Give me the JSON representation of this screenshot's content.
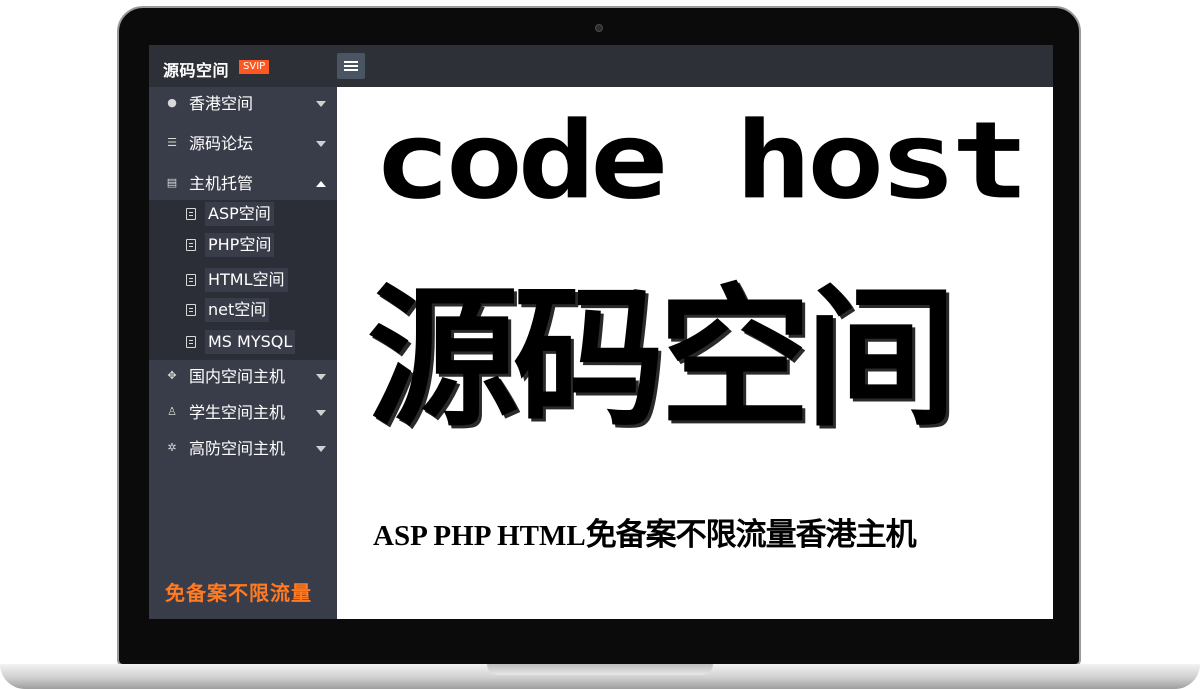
{
  "header": {
    "logo_text": "源码空间",
    "badge": "SVIP",
    "menu_icon": "hamburger-icon"
  },
  "sidebar": {
    "items": [
      {
        "label": "香港空间",
        "icon": "globe-icon"
      },
      {
        "label": "源码论坛",
        "icon": "sliders-icon"
      },
      {
        "label": "主机托管",
        "icon": "document-icon",
        "expanded": true
      },
      {
        "label": "国内空间主机",
        "icon": "expand-icon"
      },
      {
        "label": "学生空间主机",
        "icon": "user-icon"
      },
      {
        "label": "高防空间主机",
        "icon": "gear-icon"
      }
    ],
    "submenu": [
      {
        "label": "ASP空间",
        "icon": "file-icon"
      },
      {
        "label": "PHP空间",
        "icon": "file-icon"
      },
      {
        "label": "HTML空间",
        "icon": "file-icon"
      },
      {
        "label": "net空间",
        "icon": "file-icon"
      },
      {
        "label": "MS MYSQL",
        "icon": "file-icon"
      }
    ],
    "promo": "免备案不限流量"
  },
  "main": {
    "headline_en": "code host",
    "headline_cn": "源码空间",
    "subline_en": "ASP PHP HTML",
    "subline_cn": "免备案不限流量香港主机"
  },
  "colors": {
    "topbar": "#2e3037",
    "sidebar": "#393d49",
    "submenu": "#2b2e37",
    "badge": "#ff5722",
    "promo": "#ff7a21"
  }
}
